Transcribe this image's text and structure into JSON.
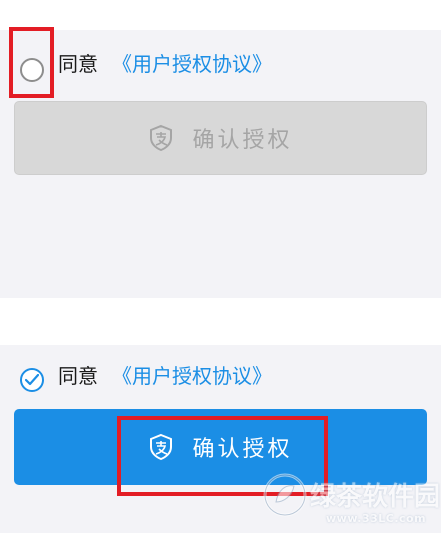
{
  "top_state": {
    "agree_text": "同意",
    "agreement_link": "《用户授权协议》",
    "button_label": "确认授权",
    "button_icon": "alipay-shield-icon",
    "radio_checked": false
  },
  "bottom_state": {
    "agree_text": "同意",
    "agreement_link": "《用户授权协议》",
    "button_label": "确认授权",
    "button_icon": "alipay-shield-icon",
    "radio_checked": true
  },
  "watermark": {
    "title": "绿茶软件园",
    "url": "www.33LC.com"
  },
  "colors": {
    "accent": "#1b8ee5",
    "disabled_button": "#d8d8d8",
    "highlight": "#e31d25",
    "panel_background": "#f3f3f7"
  }
}
